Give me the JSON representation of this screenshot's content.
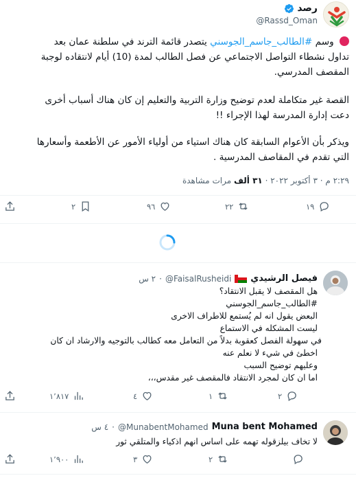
{
  "tweet": {
    "author_name": "رصد",
    "author_handle": "@Rassd_Oman",
    "p1_hashtag": "#الطالب_جاسم_الجوسني",
    "p1_before": "وسم",
    "p1_after": "يتصدر قائمة الترند في سلطنة عمان بعد",
    "p1_line2": "تداول نشطاء التواصل الاجتماعي عن فصل الطالب لمدة (10) أيام لانتقاده لوجبة",
    "p1_line3": "المقصف المدرسي.",
    "p2_line1": "القصة غير متكاملة لعدم توضيح وزارة التربية والتعليم إن كان هناك أسباب أخرى",
    "p2_line2": "دعت إدارة المدرسة لهذا الإجراء !!",
    "p3_line1": "ويذكر بأن الأعوام السابقة كان هناك استياء من أولياء الأمور عن الأطعمة وأسعارها",
    "p3_line2": "التي تقدم في المقاصف المدرسية .",
    "meta_time": "٢:٢٩ م · ٣ أكتوبر ٢٠٢٢ ·",
    "meta_views_count": "٣١ ألف",
    "meta_views_label": "مرات مشاهدة",
    "actions": {
      "replies": "١٩",
      "retweets": "٢٢",
      "likes": "٩٦",
      "bookmarks": "٢"
    }
  },
  "replies": [
    {
      "name": "فيصل الرشيدي",
      "handle": "@FaisalRusheidi",
      "time": "٢ س",
      "lines": [
        "هل المقصف لا يقبل الانتقاد؟",
        "#الطالب_جاسم_الجوسني",
        "البعض يقول انه لم يُستمع للاطراف الاخرى",
        "ليست المشكله في الاستماع",
        "في سهولة الفصل كعقوبة بدلاً من التعامل معه كطالب بالتوجيه والارشاد ان كان",
        "اخطئ في شيء لا نعلم عنه",
        "وعليهم توضيح السبب",
        "اما ان كان لمجرد الانتقاد فالمقصف غير مقدس،،،"
      ],
      "actions": {
        "replies": "٢",
        "retweets": "١",
        "likes": "٤",
        "views": "١٬٨١٧"
      }
    },
    {
      "name": "Muna bent Mohamed",
      "handle": "@MunabentMohamed",
      "time": "٤ س",
      "lines": [
        "لا تخاف بيلزقوله تهمه على اساس انهم اذكياء والمتلقي ثور"
      ],
      "actions": {
        "replies": "",
        "retweets": "٢",
        "likes": "٣",
        "views": "١٬٩٠٠"
      }
    }
  ],
  "colors": {
    "accent": "#1d9bf0",
    "muted": "#536471",
    "red_dot": "#e0245e"
  },
  "icons": [
    "verified-badge-icon",
    "reply-icon",
    "retweet-icon",
    "like-icon",
    "bookmark-icon",
    "share-icon",
    "views-icon",
    "loading-spinner-icon",
    "oman-flag-icon"
  ]
}
